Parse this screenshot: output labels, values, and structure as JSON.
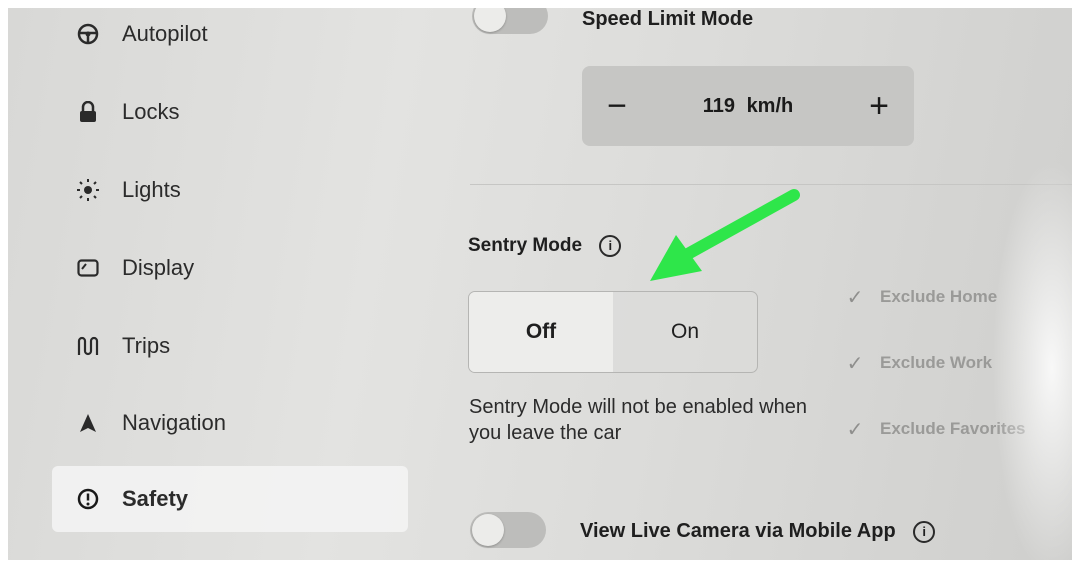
{
  "sidebar": {
    "items": [
      {
        "label": "Autopilot",
        "icon": "steering-wheel-icon"
      },
      {
        "label": "Locks",
        "icon": "lock-icon"
      },
      {
        "label": "Lights",
        "icon": "sun-icon"
      },
      {
        "label": "Display",
        "icon": "display-icon"
      },
      {
        "label": "Trips",
        "icon": "trips-icon"
      },
      {
        "label": "Navigation",
        "icon": "navigation-arrow-icon"
      },
      {
        "label": "Safety",
        "icon": "alert-circle-icon",
        "active": true
      }
    ]
  },
  "speed_limit": {
    "label": "Speed Limit Mode",
    "minus_label": "−",
    "value": "119",
    "unit": "km/h",
    "plus_label": "+"
  },
  "sentry": {
    "label": "Sentry Mode",
    "info_icon": "i",
    "options": [
      "Off",
      "On"
    ],
    "selected": "Off",
    "description": "Sentry Mode will not be enabled when you leave the car",
    "exclusions": [
      {
        "label": "Exclude Home",
        "checked": true
      },
      {
        "label": "Exclude Work",
        "checked": true
      },
      {
        "label": "Exclude Favorites",
        "checked": true
      }
    ]
  },
  "live_camera": {
    "label": "View Live Camera via Mobile App",
    "info_icon": "i"
  },
  "annotation": {
    "arrow_color": "#2ee64a"
  }
}
